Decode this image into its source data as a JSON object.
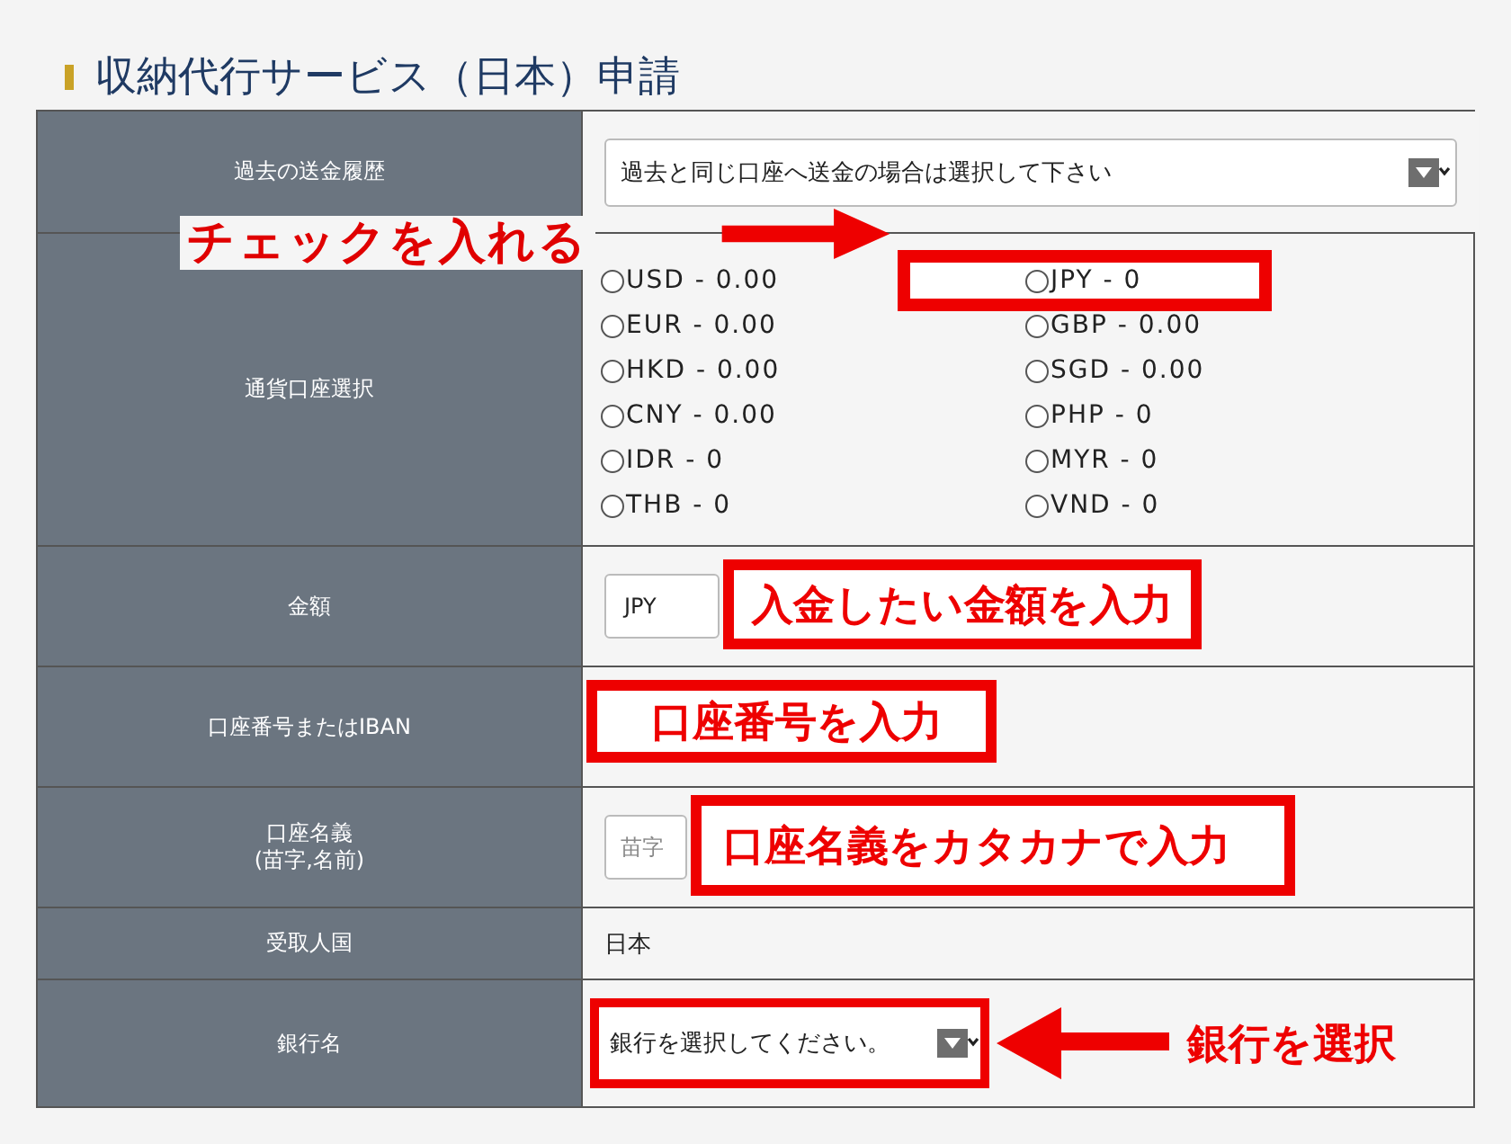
{
  "title": "収納代行サービス（日本）申請",
  "rows": [
    {
      "kind": "select",
      "label": "過去の送金履歴",
      "value": "過去と同じ口座へ送金の場合は選択して下さい"
    },
    {
      "kind": "radios",
      "label": "通貨口座選択",
      "note": "チェックを入れる",
      "options": [
        {
          "label": "USD - 0.00",
          "selected": false
        },
        {
          "label": "JPY - 0",
          "selected": false,
          "highlighted": true
        },
        {
          "label": "EUR - 0.00",
          "selected": false
        },
        {
          "label": "GBP - 0.00",
          "selected": false
        },
        {
          "label": "HKD - 0.00",
          "selected": false
        },
        {
          "label": "SGD - 0.00",
          "selected": false
        },
        {
          "label": "CNY - 0.00",
          "selected": false
        },
        {
          "label": "PHP - 0",
          "selected": false
        },
        {
          "label": "IDR - 0",
          "selected": false
        },
        {
          "label": "MYR - 0",
          "selected": false
        },
        {
          "label": "THB - 0",
          "selected": false
        },
        {
          "label": "VND - 0",
          "selected": false
        }
      ]
    },
    {
      "kind": "amount",
      "label": "金額",
      "value": "JPY",
      "note": "入金したい金額を入力"
    },
    {
      "kind": "input",
      "label": "口座番号またはIBAN",
      "note": "口座番号を入力"
    },
    {
      "kind": "input",
      "label": "口座名義",
      "sublabel": "(苗字,名前)",
      "placeholder": "苗字",
      "note": "口座名義をカタカナで入力"
    },
    {
      "kind": "text",
      "label": "受取人国",
      "value": "日本"
    },
    {
      "kind": "select",
      "label": "銀行名",
      "value": "銀行を選択してください。",
      "note": "銀行を選択"
    }
  ]
}
